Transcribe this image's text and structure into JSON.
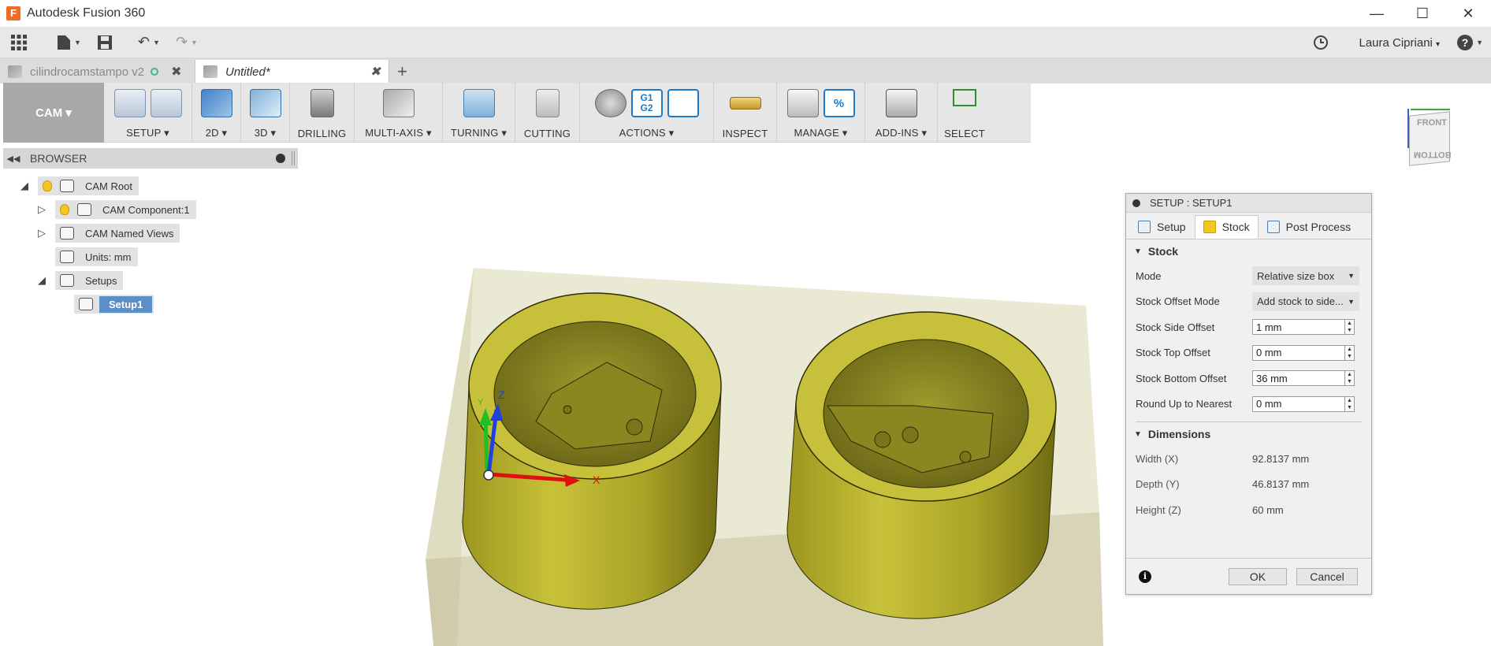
{
  "app": {
    "title": "Autodesk Fusion 360",
    "logo_letter": "F"
  },
  "quick_access": {
    "user": "Laura Cipriani",
    "user_caret": "▾",
    "help": "?"
  },
  "tabs": [
    {
      "label": "cilindrocamstampo v2",
      "active": false
    },
    {
      "label": "Untitled*",
      "active": true
    }
  ],
  "workspace": {
    "label": "CAM ▾"
  },
  "ribbon": {
    "groups": [
      {
        "label": "SETUP ▾"
      },
      {
        "label": "2D ▾"
      },
      {
        "label": "3D ▾"
      },
      {
        "label": "DRILLING"
      },
      {
        "label": "MULTI-AXIS ▾"
      },
      {
        "label": "TURNING ▾"
      },
      {
        "label": "CUTTING"
      },
      {
        "label": "ACTIONS ▾"
      },
      {
        "label": "INSPECT"
      },
      {
        "label": "MANAGE ▾"
      },
      {
        "label": "ADD-INS ▾"
      },
      {
        "label": "SELECT"
      }
    ],
    "g1g2_text": "G1\nG2",
    "post_symbol": "%"
  },
  "viewcube": {
    "front": "FRONT",
    "bottom": "BOTTOM"
  },
  "browser": {
    "title": "BROWSER",
    "nodes": [
      {
        "label": "CAM Root"
      },
      {
        "label": "CAM Component:1"
      },
      {
        "label": "CAM Named Views"
      },
      {
        "label": "Units: mm"
      },
      {
        "label": "Setups"
      },
      {
        "label": "Setup1"
      }
    ]
  },
  "axes": {
    "x": "X",
    "y": "Y",
    "z": "Z"
  },
  "dialog": {
    "title": "SETUP : SETUP1",
    "tabs": [
      "Setup",
      "Stock",
      "Post Process"
    ],
    "stock_section": "Stock",
    "fields": {
      "mode": {
        "label": "Mode",
        "value": "Relative size box"
      },
      "offset_mode": {
        "label": "Stock Offset Mode",
        "value": "Add stock to side..."
      },
      "side_offset": {
        "label": "Stock Side Offset",
        "value": "1 mm"
      },
      "top_offset": {
        "label": "Stock Top Offset",
        "value": "0 mm"
      },
      "bottom_offset": {
        "label": "Stock Bottom Offset",
        "value": "36 mm"
      },
      "round_up": {
        "label": "Round Up to Nearest",
        "value": "0 mm"
      }
    },
    "dimensions_section": "Dimensions",
    "dimensions": {
      "width": {
        "label": "Width (X)",
        "value": "92.8137 mm"
      },
      "depth": {
        "label": "Depth (Y)",
        "value": "46.8137 mm"
      },
      "height": {
        "label": "Height (Z)",
        "value": "60 mm"
      }
    },
    "ok": "OK",
    "cancel": "Cancel"
  },
  "colors": {
    "model_yellow": "#8f8a1f",
    "stock_box": "#c9c6a0",
    "selection_blue": "#5b8fc7"
  }
}
